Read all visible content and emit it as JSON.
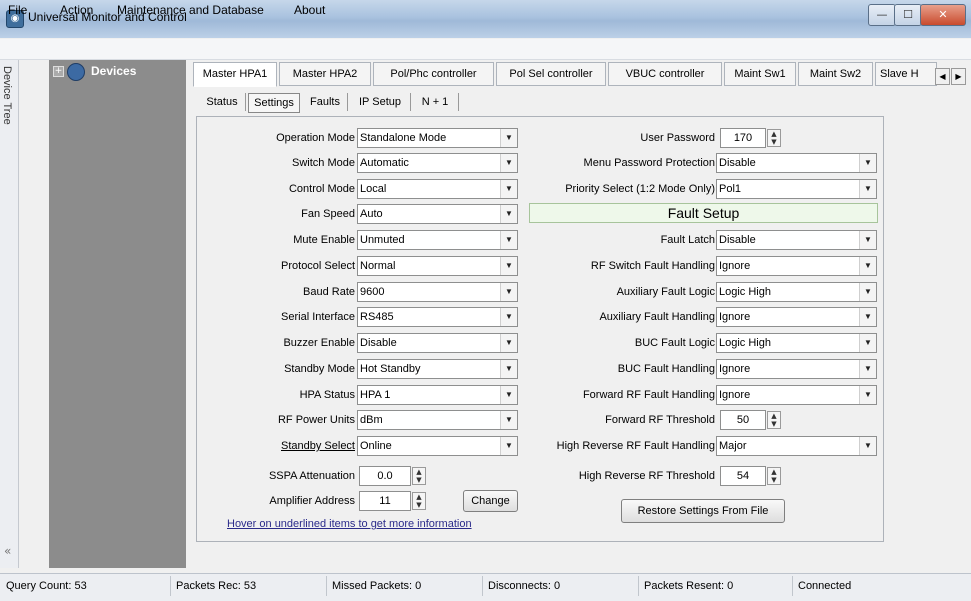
{
  "window": {
    "title": "Universal Monitor and Control",
    "min": "—",
    "max": "☐",
    "close": "✕"
  },
  "menu": [
    "File",
    "Action",
    "Maintenance and Database",
    "About"
  ],
  "left_strip": {
    "label": "Device Tree",
    "collapse_glyph": "«"
  },
  "tree": {
    "expander": "+",
    "label": "Devices"
  },
  "top_tabs": [
    "Master HPA1",
    "Master HPA2",
    "Pol/Phc controller",
    "Pol Sel controller",
    "VBUC controller",
    "Maint Sw1",
    "Maint Sw2",
    "Slave H"
  ],
  "top_tab_scroll": {
    "left": "◀",
    "right": "▶"
  },
  "sub_tabs": [
    "Status",
    "Settings",
    "Faults",
    "IP Setup",
    "N + 1"
  ],
  "left_fields": [
    {
      "label": "Operation Mode",
      "value": "Standalone Mode"
    },
    {
      "label": "Switch Mode",
      "value": "Automatic"
    },
    {
      "label": "Control Mode",
      "value": "Local"
    },
    {
      "label": "Fan Speed",
      "value": "Auto"
    },
    {
      "label": "Mute Enable",
      "value": "Unmuted"
    },
    {
      "label": "Protocol Select",
      "value": "Normal"
    },
    {
      "label": "Baud Rate",
      "value": "9600"
    },
    {
      "label": "Serial Interface",
      "value": "RS485"
    },
    {
      "label": "Buzzer Enable",
      "value": "Disable"
    },
    {
      "label": "Standby Mode",
      "value": "Hot Standby"
    },
    {
      "label": "HPA Status",
      "value": "HPA 1"
    },
    {
      "label": "RF Power Units",
      "value": "dBm"
    },
    {
      "label": "Standby Select",
      "value": "Online"
    }
  ],
  "sspa_attenuation": {
    "label": "SSPA Attenuation",
    "value": "0.0"
  },
  "amplifier_address": {
    "label": "Amplifier Address",
    "value": "11",
    "button": "Change"
  },
  "hover_note": "Hover on underlined items to get more information",
  "right_top": {
    "user_password": {
      "label": "User Password",
      "value": "170"
    },
    "menu_password": {
      "label": "Menu Password Protection",
      "value": "Disable"
    },
    "priority_select": {
      "label": "Priority Select (1:2 Mode Only)",
      "value": "Pol1"
    }
  },
  "fault_setup_title": "Fault Setup",
  "fault_fields": [
    {
      "label": "Fault Latch",
      "value": "Disable"
    },
    {
      "label": "RF Switch Fault Handling",
      "value": "Ignore"
    },
    {
      "label": "Auxiliary Fault Logic",
      "value": "Logic High"
    },
    {
      "label": "Auxiliary Fault Handling",
      "value": "Ignore"
    },
    {
      "label": "BUC Fault Logic",
      "value": "Logic High"
    },
    {
      "label": "BUC Fault Handling",
      "value": "Ignore"
    },
    {
      "label": "Forward RF Fault Handling",
      "value": "Ignore"
    }
  ],
  "forward_rf_threshold": {
    "label": "Forward RF Threshold",
    "value": "50"
  },
  "high_reverse_handling": {
    "label": "High Reverse RF Fault Handling",
    "value": "Major"
  },
  "high_reverse_threshold": {
    "label": "High Reverse RF Threshold",
    "value": "54"
  },
  "restore_button": "Restore Settings From File",
  "status": {
    "query_count": "Query Count: 53",
    "packets_rec": "Packets Rec: 53",
    "missed": "Missed Packets: 0",
    "disconnects": "Disconnects: 0",
    "resent": "Packets Resent: 0",
    "connection": "Connected"
  },
  "glyphs": {
    "dropdown": "▼",
    "spin_up": "▲",
    "spin_down": "▼"
  }
}
